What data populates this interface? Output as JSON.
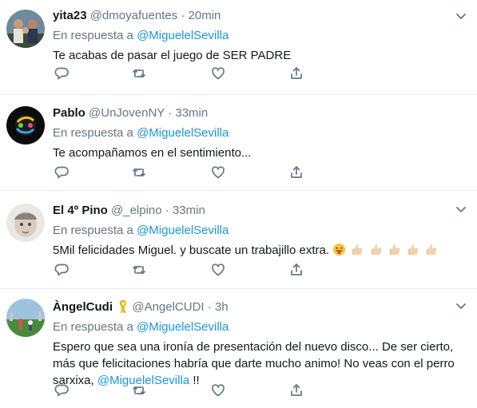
{
  "colors": {
    "link": "#1b95e0",
    "secondary": "#657786",
    "text": "#14171a",
    "divider": "#e6ecf0"
  },
  "tweets": [
    {
      "name": "yita23",
      "handle": "@dmoyafuentes",
      "dot": "·",
      "time": "20min",
      "reply_prefix": "En respuesta a",
      "reply_mention": "@MiguelelSevilla",
      "text": "Te acabas de pasar el juego de SER PADRE"
    },
    {
      "name": "Pablo",
      "handle": "@UnJovenNY",
      "dot": "·",
      "time": "33min",
      "reply_prefix": "En respuesta a",
      "reply_mention": "@MiguelelSevilla",
      "text": "Te acompañamos en el sentimiento..."
    },
    {
      "name": "El 4º Pino",
      "handle": "@_elpino",
      "dot": "·",
      "time": "33min",
      "reply_prefix": "En respuesta a",
      "reply_mention": "@MiguelelSevilla",
      "text": "5Mil felicidades Miguel. y buscate un trabajillo extra.",
      "emojis": [
        "tongue-face-emoji",
        "thumbs-up-emoji",
        "thumbs-up-emoji",
        "thumbs-up-emoji",
        "thumbs-up-emoji",
        "thumbs-up-emoji"
      ]
    },
    {
      "name": "ÀngelCudi",
      "name_badge": "yellow-ribbon-icon",
      "handle": "@AngelCUDI",
      "dot": "·",
      "time": "3h",
      "reply_prefix": "En respuesta a",
      "reply_mention": "@MiguelelSevilla",
      "text_part1": "Espero que sea una ironía de presentación del nuevo disco... De ser cierto, más que felicitaciones habría que darte mucho animo! No veas con el perro sarxixa,",
      "text_mention": "@MiguelelSevilla",
      "text_part2": "!!"
    }
  ],
  "icons": {
    "reply": "reply-icon",
    "retweet": "retweet-icon",
    "like": "like-heart-icon",
    "share": "share-icon",
    "more": "chevron-down-icon"
  }
}
